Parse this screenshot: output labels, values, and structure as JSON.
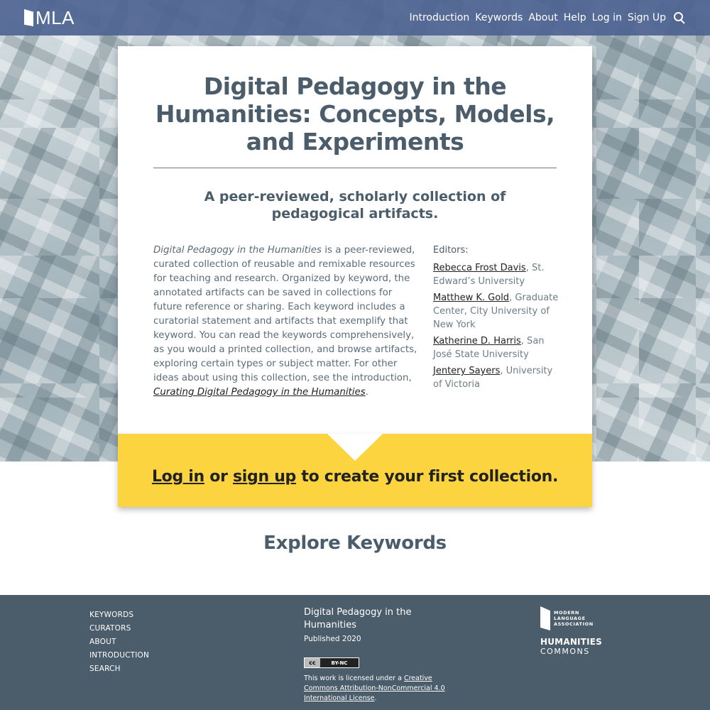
{
  "header": {
    "logo_text": "MLA",
    "nav": [
      {
        "label": "Introduction"
      },
      {
        "label": "Keywords"
      },
      {
        "label": "About"
      },
      {
        "label": "Help"
      },
      {
        "label": "Log in"
      },
      {
        "label": "Sign Up"
      }
    ],
    "search_icon": "search-icon"
  },
  "card": {
    "title": "Digital Pedagogy in the Humanities: Concepts, Models, and Experiments",
    "subtitle": "A peer-reviewed, scholarly collection of pedagogical artifacts.",
    "intro_lead": "Digital Pedagogy in the Humanities",
    "intro_body": " is a peer-reviewed, curated collection of reusable and remixable resources for teaching and research. Organized by keyword, the annotated artifacts can be saved in collections for future reference or sharing. Each keyword includes a curatorial statement and artifacts that exemplify that keyword. You can read the keywords comprehensively, as you would a printed collection, and browse artifacts, exploring certain types or subject matter. For other ideas about using this collection, see the introduction, ",
    "intro_link": "Curating Digital Pedagogy in the Humanities",
    "intro_end": ".",
    "editors_heading": "Editors:",
    "editors": [
      {
        "name": "Rebecca Frost Davis",
        "affiliation": ", St. Edward’s University"
      },
      {
        "name": "Matthew K. Gold",
        "affiliation": ", Graduate Center, City University of New York"
      },
      {
        "name": "Katherine D. Harris",
        "affiliation": ", San José State University"
      },
      {
        "name": "Jentery Sayers",
        "affiliation": ", University of Victoria"
      }
    ]
  },
  "callout": {
    "login": "Log in",
    "or": " or ",
    "signup": "sign up",
    "rest": " to create your first collection."
  },
  "explore": {
    "title": "Explore Keywords"
  },
  "footer": {
    "links": [
      "KEYWORDS",
      "CURATORS",
      "ABOUT",
      "INTRODUCTION",
      "SEARCH"
    ],
    "site_name": "Digital Pedagogy in the Humanities",
    "published": "Published 2020",
    "cc_badge_left": "cc",
    "cc_badge_right": "BY-NC",
    "license_prefix": "This work is licensed under a ",
    "license_link": "Creative Commons Attribution-NonCommercial 4.0 International License",
    "license_end": ".",
    "mla_logo_words": [
      "MODERN",
      "LANGUAGE",
      "ASSOCIATION"
    ],
    "hc_top": "HUMANITIES",
    "hc_bottom": "COMMONS"
  },
  "colors": {
    "header_bg": "#4d6391",
    "callout_bg": "#fcd43f",
    "footer_bg": "#4b5c6a",
    "text": "#4b5d6b"
  }
}
